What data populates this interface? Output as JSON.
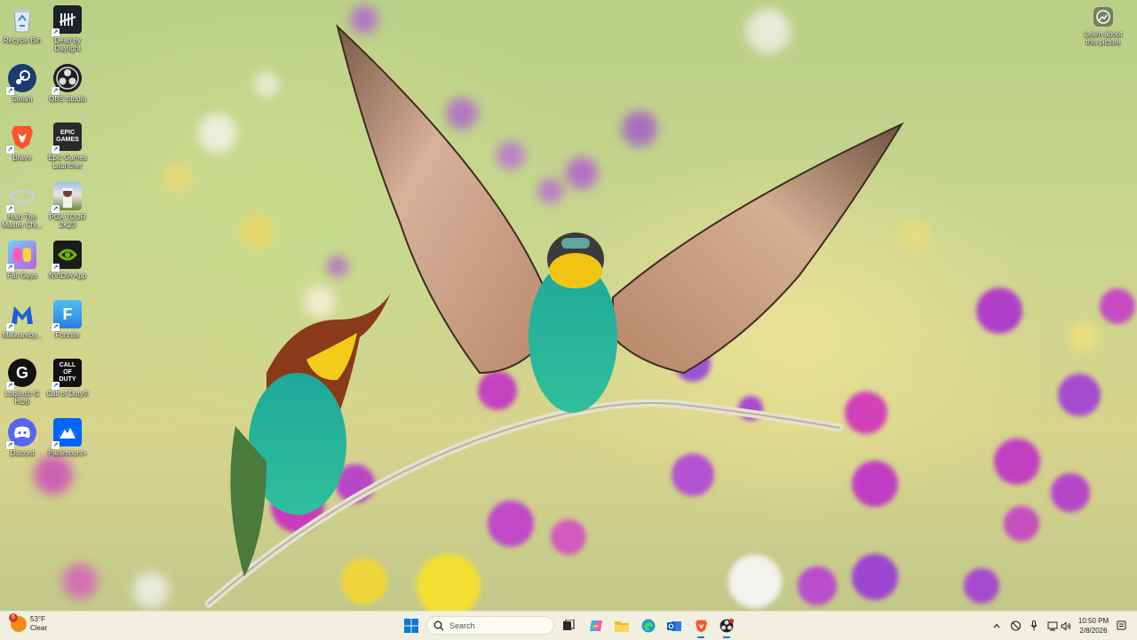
{
  "desktop": {
    "icons": [
      {
        "label": "Recycle Bin",
        "icon": "recycle-bin-icon"
      },
      {
        "label": "Dead by Daylight",
        "icon": "dead-by-daylight-icon"
      },
      {
        "label": "Steam",
        "icon": "steam-icon"
      },
      {
        "label": "OBS Studio",
        "icon": "obs-studio-icon"
      },
      {
        "label": "Brave",
        "icon": "brave-icon"
      },
      {
        "label": "Epic Games Launcher",
        "icon": "epic-games-icon"
      },
      {
        "label": "Halo The Master Chi...",
        "icon": "halo-icon"
      },
      {
        "label": "PGA TOUR 2K23",
        "icon": "pga-tour-icon"
      },
      {
        "label": "Fall Guys",
        "icon": "fall-guys-icon"
      },
      {
        "label": "NVIDIA App",
        "icon": "nvidia-icon"
      },
      {
        "label": "Malwareby...",
        "icon": "malwarebytes-icon"
      },
      {
        "label": "Fortnite",
        "icon": "fortnite-icon"
      },
      {
        "label": "Logitech G HUB",
        "icon": "logitech-g-hub-icon"
      },
      {
        "label": "Call of Duty®",
        "icon": "call-of-duty-icon"
      },
      {
        "label": "Discord",
        "icon": "discord-icon"
      },
      {
        "label": "Paramount+",
        "icon": "paramount-plus-icon"
      }
    ],
    "learn_about_picture": "Learn about this picture",
    "icon_glyphs": {
      "epic": "EPIC\nGAMES",
      "cod": "CALL\nOF\nDUTY",
      "fortnite": "F",
      "logitech": "G"
    }
  },
  "taskbar": {
    "weather": {
      "temp": "53°F",
      "condition": "Clear",
      "badge": "6"
    },
    "search_placeholder": "Search",
    "apps": [
      "task-view-icon",
      "copilot-icon",
      "file-explorer-icon",
      "edge-icon",
      "outlook-icon",
      "brave-icon",
      "obs-studio-icon"
    ],
    "clock": {
      "time": "10:50 PM",
      "date": "2/8/2026"
    }
  },
  "colors": {
    "taskbar_bg": "#f0efe0",
    "accent": "#1a73c8"
  }
}
